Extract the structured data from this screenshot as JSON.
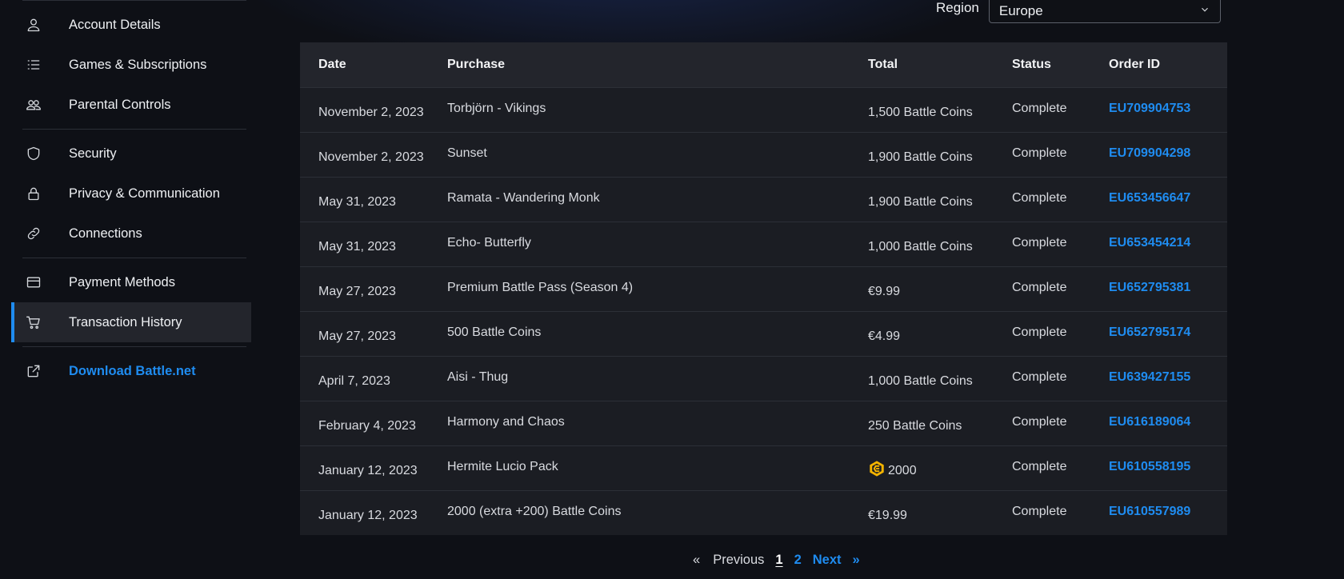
{
  "sidebar": {
    "items": [
      {
        "label": "Account Details",
        "icon": "user-icon"
      },
      {
        "label": "Games & Subscriptions",
        "icon": "list-icon"
      },
      {
        "label": "Parental Controls",
        "icon": "users-icon"
      },
      {
        "label": "Security",
        "icon": "shield-icon"
      },
      {
        "label": "Privacy & Communication",
        "icon": "lock-icon"
      },
      {
        "label": "Connections",
        "icon": "link-icon"
      },
      {
        "label": "Payment Methods",
        "icon": "credit-card-icon"
      },
      {
        "label": "Transaction History",
        "icon": "cart-icon",
        "active": true
      },
      {
        "label": "Download Battle.net",
        "icon": "external-link-icon"
      }
    ]
  },
  "region": {
    "label": "Region",
    "selected": "Europe"
  },
  "table": {
    "headers": {
      "date": "Date",
      "purchase": "Purchase",
      "total": "Total",
      "status": "Status",
      "order_id": "Order ID"
    },
    "rows": [
      {
        "date": "November 2, 2023",
        "purchase": "Torbjörn - Vikings",
        "total": "1,500 Battle Coins",
        "status": "Complete",
        "order_id": "EU709904753"
      },
      {
        "date": "November 2, 2023",
        "purchase": "Sunset",
        "total": "1,900 Battle Coins",
        "status": "Complete",
        "order_id": "EU709904298"
      },
      {
        "date": "May 31, 2023",
        "purchase": "Ramata - Wandering Monk",
        "total": "1,900 Battle Coins",
        "status": "Complete",
        "order_id": "EU653456647"
      },
      {
        "date": "May 31, 2023",
        "purchase": "Echo- Butterfly",
        "total": "1,000 Battle Coins",
        "status": "Complete",
        "order_id": "EU653454214"
      },
      {
        "date": "May 27, 2023",
        "purchase": "Premium Battle Pass (Season 4)",
        "total": "€9.99",
        "status": "Complete",
        "order_id": "EU652795381"
      },
      {
        "date": "May 27, 2023",
        "purchase": "500 Battle Coins",
        "total": "€4.99",
        "status": "Complete",
        "order_id": "EU652795174"
      },
      {
        "date": "April 7, 2023",
        "purchase": "Aisi - Thug",
        "total": "1,000 Battle Coins",
        "status": "Complete",
        "order_id": "EU639427155"
      },
      {
        "date": "February 4, 2023",
        "purchase": "Harmony and Chaos",
        "total": "250 Battle Coins",
        "status": "Complete",
        "order_id": "EU616189064"
      },
      {
        "date": "January 12, 2023",
        "purchase": "Hermite Lucio Pack",
        "total": "2000",
        "status": "Complete",
        "order_id": "EU610558195"
      },
      {
        "date": "January 12, 2023",
        "purchase": "2000 (extra +200) Battle Coins",
        "total": "€19.99",
        "status": "Complete",
        "order_id": "EU610557989"
      }
    ]
  },
  "pagination": {
    "prev_arrow": "«",
    "prev_label": "Previous",
    "pages": [
      "1",
      "2"
    ],
    "next_label": "Next",
    "next_arrow": "»"
  },
  "colors": {
    "accent": "#1f8cf0",
    "coin": "#f5b400"
  }
}
